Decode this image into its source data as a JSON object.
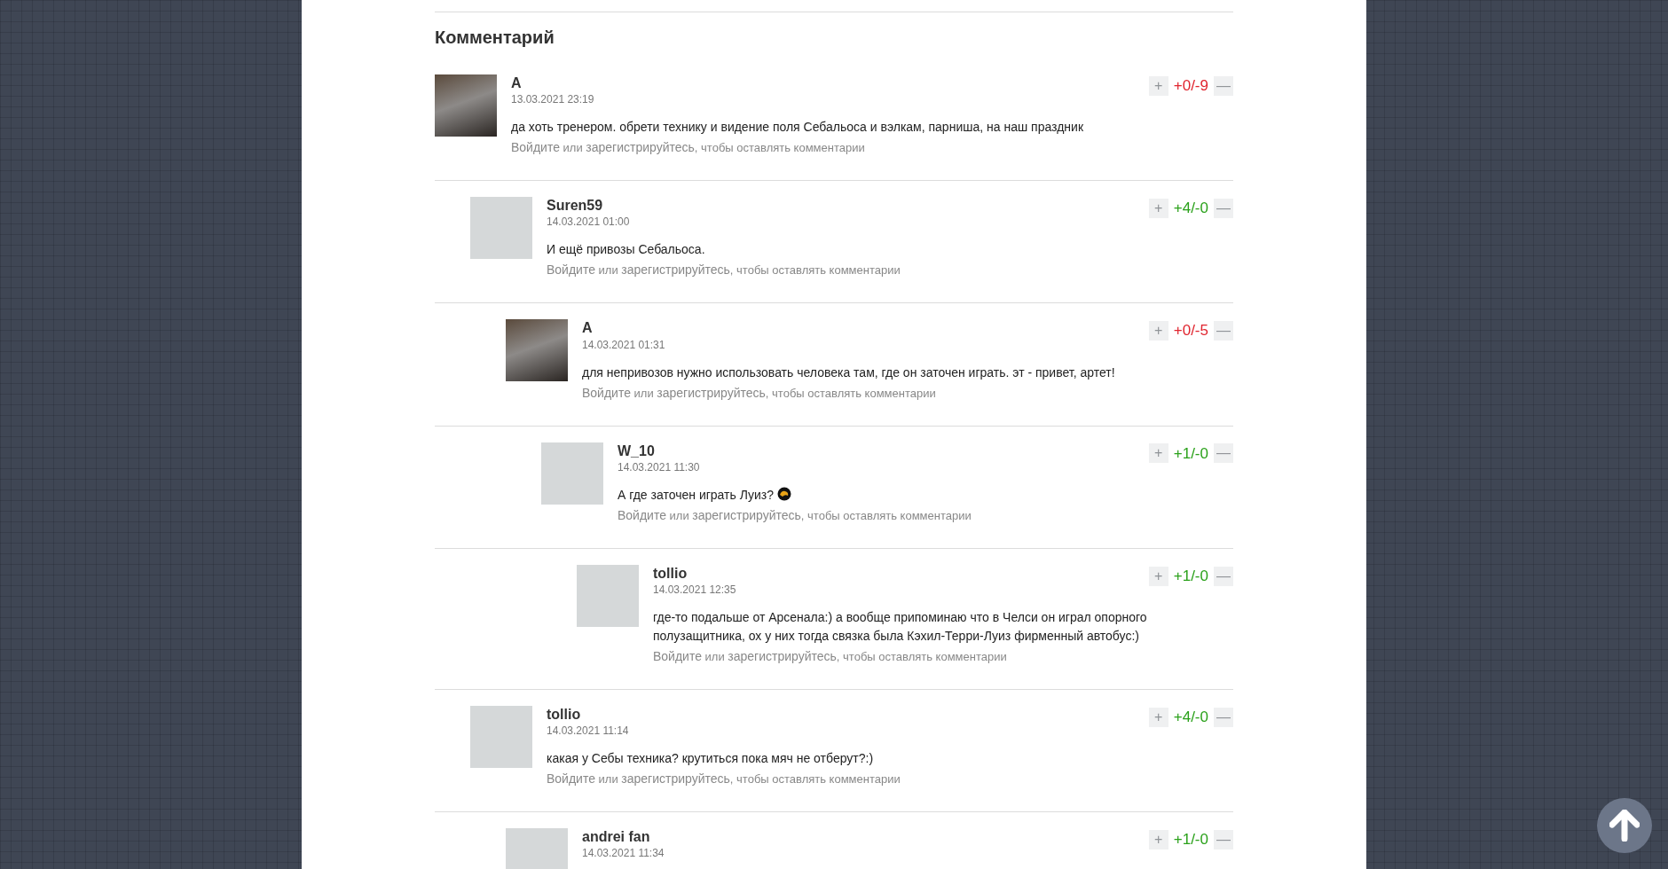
{
  "section_title": "Комментарий",
  "comments": [
    {
      "author": "A",
      "date": "13.03.2021 23:19",
      "photo": true,
      "text": "да хоть тренером. обрети технику и видение поля Себальоса и вэлкам, парниша, на наш праздник",
      "login": "Войдите",
      "or": "или",
      "register": "зарегистрируйтесь",
      "suffix": ", чтобы оставлять комментарии",
      "plus": "+",
      "score": "+0/-9",
      "color": "#e0242e",
      "minus": "—",
      "children": [
        {
          "author": "Suren59",
          "date": "14.03.2021 01:00",
          "photo": false,
          "text": "И ещё привозы Себальоса.",
          "login": "Войдите",
          "or": "или",
          "register": "зарегистрируйтесь",
          "suffix": ", чтобы оставлять комментарии",
          "plus": "+",
          "score": "+4/-0",
          "color": "#2aa11a",
          "minus": "—",
          "children": [
            {
              "author": "A",
              "date": "14.03.2021 01:31",
              "photo": true,
              "text": "для непривозов нужно использовать человека там, где он заточен играть. эт - привет, артет!",
              "login": "Войдите",
              "or": "или",
              "register": "зарегистрируйтесь",
              "suffix": ", чтобы оставлять комментарии",
              "plus": "+",
              "score": "+0/-5",
              "color": "#e0242e",
              "minus": "—",
              "children": [
                {
                  "author": "W_10",
                  "date": "14.03.2021 11:30",
                  "photo": false,
                  "text": "А где заточен играть Луиз?",
                  "emoji": true,
                  "login": "Войдите",
                  "or": "или",
                  "register": "зарегистрируйтесь",
                  "suffix": ", чтобы оставлять комментарии",
                  "plus": "+",
                  "score": "+1/-0",
                  "color": "#2aa11a",
                  "minus": "—",
                  "children": [
                    {
                      "author": "tollio",
                      "date": "14.03.2021 12:35",
                      "photo": false,
                      "text": "где-то подальше от Арсенала:) а вообще припоминаю что в Челси он играл опорного полузащитника, ох у них тогда связка была Кэхил-Терри-Луиз фирменный автобус:)",
                      "login": "Войдите",
                      "or": "или",
                      "register": "зарегистрируйтесь",
                      "suffix": ", чтобы оставлять комментарии",
                      "plus": "+",
                      "score": "+1/-0",
                      "color": "#2aa11a",
                      "minus": "—"
                    }
                  ]
                }
              ]
            }
          ]
        },
        {
          "author": "tollio",
          "date": "14.03.2021 11:14",
          "photo": false,
          "text": "какая у Себы техника? крутиться пока мяч не отберут?:)",
          "login": "Войдите",
          "or": "или",
          "register": "зарегистрируйтесь",
          "suffix": ", чтобы оставлять комментарии",
          "plus": "+",
          "score": "+4/-0",
          "color": "#2aa11a",
          "minus": "—",
          "children": [
            {
              "author": "andrei fan",
              "date": "14.03.2021 11:34",
              "photo": false,
              "plus": "+",
              "score": "+1/-0",
              "color": "#2aa11a",
              "minus": "—"
            }
          ]
        }
      ]
    }
  ]
}
